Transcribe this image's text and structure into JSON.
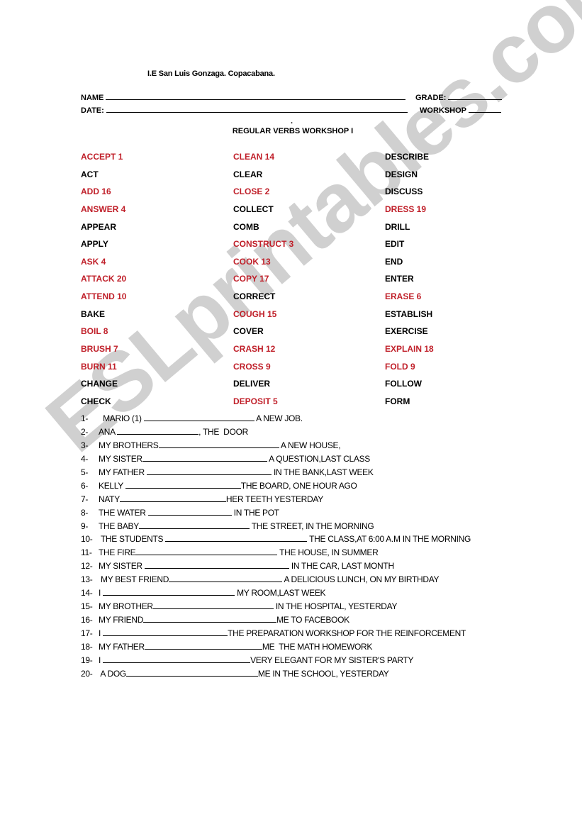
{
  "header": {
    "school": "I.E San Luis Gonzaga. Copacabana.",
    "name_label": "NAME",
    "grade_label": "GRADE:",
    "date_label": "DATE:",
    "workshop_label": "WORKSHOP",
    "dot": ".",
    "title": "REGULAR VERBS WORKSHOP I"
  },
  "verbs": {
    "columns": [
      [
        {
          "text": "ACCEPT 1",
          "marked": true
        },
        {
          "text": "ACT",
          "marked": false
        },
        {
          "text": "ADD 16",
          "marked": true
        },
        {
          "text": "ANSWER 4",
          "marked": true
        },
        {
          "text": "APPEAR",
          "marked": false
        },
        {
          "text": "APPLY",
          "marked": false
        },
        {
          "text": "ASK 4",
          "marked": true
        },
        {
          "text": "ATTACK  20",
          "marked": true
        },
        {
          "text": "ATTEND 10",
          "marked": true
        },
        {
          "text": "BAKE",
          "marked": false
        },
        {
          "text": "BOIL 8",
          "marked": true
        },
        {
          "text": "BRUSH 7",
          "marked": true
        },
        {
          "text": "BURN 11",
          "marked": true
        },
        {
          "text": "CHANGE",
          "marked": false
        },
        {
          "text": "CHECK",
          "marked": false
        }
      ],
      [
        {
          "text": "CLEAN 14",
          "marked": true
        },
        {
          "text": "CLEAR",
          "marked": false
        },
        {
          "text": "CLOSE 2",
          "marked": true
        },
        {
          "text": "COLLECT",
          "marked": false
        },
        {
          "text": "COMB",
          "marked": false
        },
        {
          "text": "CONSTRUCT 3",
          "marked": true
        },
        {
          "text": "COOK 13",
          "marked": true
        },
        {
          "text": "COPY 17",
          "marked": true
        },
        {
          "text": "CORRECT",
          "marked": false
        },
        {
          "text": "COUGH 15",
          "marked": true
        },
        {
          "text": "COVER",
          "marked": false
        },
        {
          "text": "CRASH 12",
          "marked": true
        },
        {
          "text": "CROSS 9",
          "marked": true
        },
        {
          "text": "DELIVER",
          "marked": false
        },
        {
          "text": "DEPOSIT 5",
          "marked": true
        }
      ],
      [
        {
          "text": "DESCRIBE",
          "marked": false
        },
        {
          "text": "DESIGN",
          "marked": false
        },
        {
          "text": "DISCUSS",
          "marked": false
        },
        {
          "text": "DRESS 19",
          "marked": true
        },
        {
          "text": "DRILL",
          "marked": false
        },
        {
          "text": "EDIT",
          "marked": false
        },
        {
          "text": "END",
          "marked": false
        },
        {
          "text": "ENTER",
          "marked": false
        },
        {
          "text": "ERASE 6",
          "marked": true
        },
        {
          "text": "ESTABLISH",
          "marked": false
        },
        {
          "text": "EXERCISE",
          "marked": false
        },
        {
          "text": "EXPLAIN 18",
          "marked": true
        },
        {
          "text": "FOLD 9",
          "marked": true
        },
        {
          "text": "FOLLOW",
          "marked": false
        },
        {
          "text": "FORM",
          "marked": false
        }
      ]
    ]
  },
  "sentences": [
    {
      "num": "1-",
      "before": "  MARIO (1) ",
      "after": " A NEW JOB."
    },
    {
      "num": "2-",
      "before": "ANA ",
      "after": ", THE  DOOR"
    },
    {
      "num": "3-",
      "before": "MY BROTHERS",
      "after": " A NEW HOUSE,"
    },
    {
      "num": "4-",
      "before": "MY SISTER",
      "after": " A QUESTION,LAST CLASS"
    },
    {
      "num": "5-",
      "before": "MY FATHER ",
      "after": " IN THE BANK,LAST WEEK"
    },
    {
      "num": "6-",
      "before": "KELLY ",
      "after": "THE BOARD, ONE HOUR AGO"
    },
    {
      "num": "7-",
      "before": "NATY",
      "after": "HER TEETH YESTERDAY"
    },
    {
      "num": "8-",
      "before": "THE WATER ",
      "after": " IN THE POT"
    },
    {
      "num": "9-",
      "before": "THE BABY",
      "after": " THE STREET, IN THE MORNING"
    },
    {
      "num": "10-",
      "before": " THE STUDENTS ",
      "after": " THE CLASS,AT 6:00 A.M IN THE MORNING"
    },
    {
      "num": "11-",
      "before": "THE FIRE",
      "after": " THE HOUSE, IN SUMMER"
    },
    {
      "num": "12-",
      "before": "MY SISTER ",
      "after": " IN THE CAR, LAST MONTH"
    },
    {
      "num": "13-",
      "before": " MY BEST FRIEND",
      "after": " A DELICIOUS LUNCH, ON MY BIRTHDAY"
    },
    {
      "num": "14-",
      "before": "I ",
      "after": " MY ROOM,LAST WEEK"
    },
    {
      "num": "15-",
      "before": "MY BROTHER",
      "after": " IN THE HOSPITAL, YESTERDAY"
    },
    {
      "num": "16-",
      "before": "MY FRIEND",
      "after": "ME TO FACEBOOK"
    },
    {
      "num": "17-",
      "before": "I ",
      "after": "THE PREPARATION WORKSHOP FOR THE REINFORCEMENT"
    },
    {
      "num": "18-",
      "before": "MY FATHER",
      "after": "ME  THE MATH HOMEWORK"
    },
    {
      "num": "19-",
      "before": "I ",
      "after": "VERY ELEGANT FOR MY SISTER'S PARTY"
    },
    {
      "num": "20-",
      "before": " A DOG",
      "after": "ME IN THE SCHOOL, YESTERDAY"
    }
  ],
  "watermark": "ESLprintables.com",
  "colors": {
    "marked_verb": "#c0202a",
    "watermark": "#c8c8c8"
  }
}
